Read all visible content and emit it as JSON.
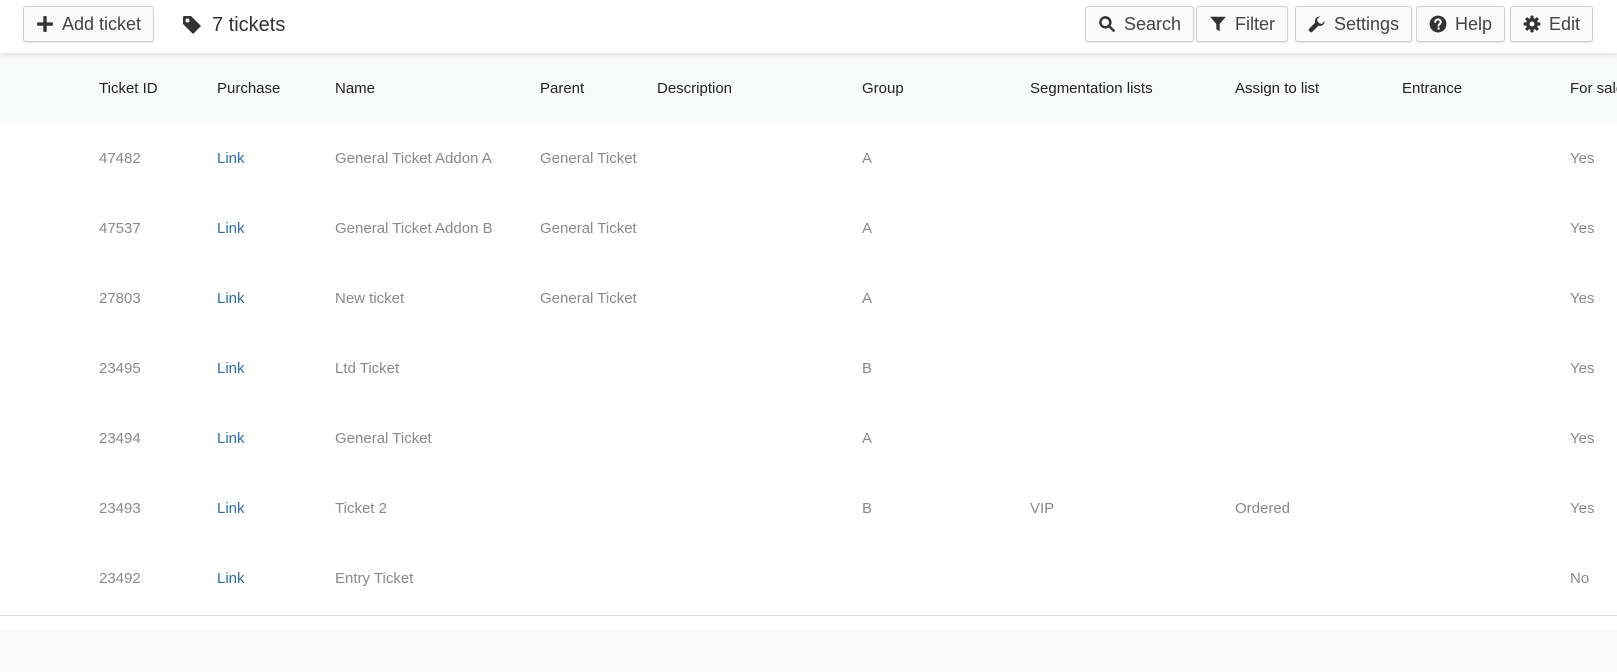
{
  "toolbar": {
    "add_ticket_label": "Add ticket",
    "ticket_count": "7 tickets",
    "search_label": "Search",
    "filter_label": "Filter",
    "settings_label": "Settings",
    "help_label": "Help",
    "edit_label": "Edit"
  },
  "table": {
    "columns": [
      "Ticket ID",
      "Purchase",
      "Name",
      "Parent",
      "Description",
      "Group",
      "Segmentation lists",
      "Assign to list",
      "Entrance",
      "For sale"
    ],
    "rows": [
      {
        "id": "47482",
        "purchase": "Link",
        "name": "General Ticket Addon A",
        "parent": "General Ticket",
        "description": "",
        "group": "A",
        "segmentation": "",
        "assign": "",
        "entrance": "",
        "for_sale": "Yes"
      },
      {
        "id": "47537",
        "purchase": "Link",
        "name": "General Ticket Addon B",
        "parent": "General Ticket",
        "description": "",
        "group": "A",
        "segmentation": "",
        "assign": "",
        "entrance": "",
        "for_sale": "Yes"
      },
      {
        "id": "27803",
        "purchase": "Link",
        "name": "New ticket",
        "parent": "General Ticket",
        "description": "",
        "group": "A",
        "segmentation": "",
        "assign": "",
        "entrance": "",
        "for_sale": "Yes"
      },
      {
        "id": "23495",
        "purchase": "Link",
        "name": "Ltd Ticket",
        "parent": "",
        "description": "",
        "group": "B",
        "segmentation": "",
        "assign": "",
        "entrance": "",
        "for_sale": "Yes"
      },
      {
        "id": "23494",
        "purchase": "Link",
        "name": "General Ticket",
        "parent": "",
        "description": "",
        "group": "A",
        "segmentation": "",
        "assign": "",
        "entrance": "",
        "for_sale": "Yes"
      },
      {
        "id": "23493",
        "purchase": "Link",
        "name": "Ticket 2",
        "parent": "",
        "description": "",
        "group": "B",
        "segmentation": "VIP",
        "assign": "Ordered",
        "entrance": "",
        "for_sale": "Yes"
      },
      {
        "id": "23492",
        "purchase": "Link",
        "name": "Entry Ticket",
        "parent": "",
        "description": "",
        "group": "",
        "segmentation": "",
        "assign": "",
        "entrance": "",
        "for_sale": "No"
      }
    ]
  },
  "icons": {
    "add": "plus-icon",
    "count": "tag-icon",
    "search": "search-icon",
    "filter": "filter-icon",
    "settings": "wrench-icon",
    "help": "question-circle-icon",
    "edit": "gear-icon"
  },
  "colors": {
    "link": "#2f6fa6",
    "muted_text": "#8a8a8a",
    "header_bg": "#f8f9f9"
  }
}
